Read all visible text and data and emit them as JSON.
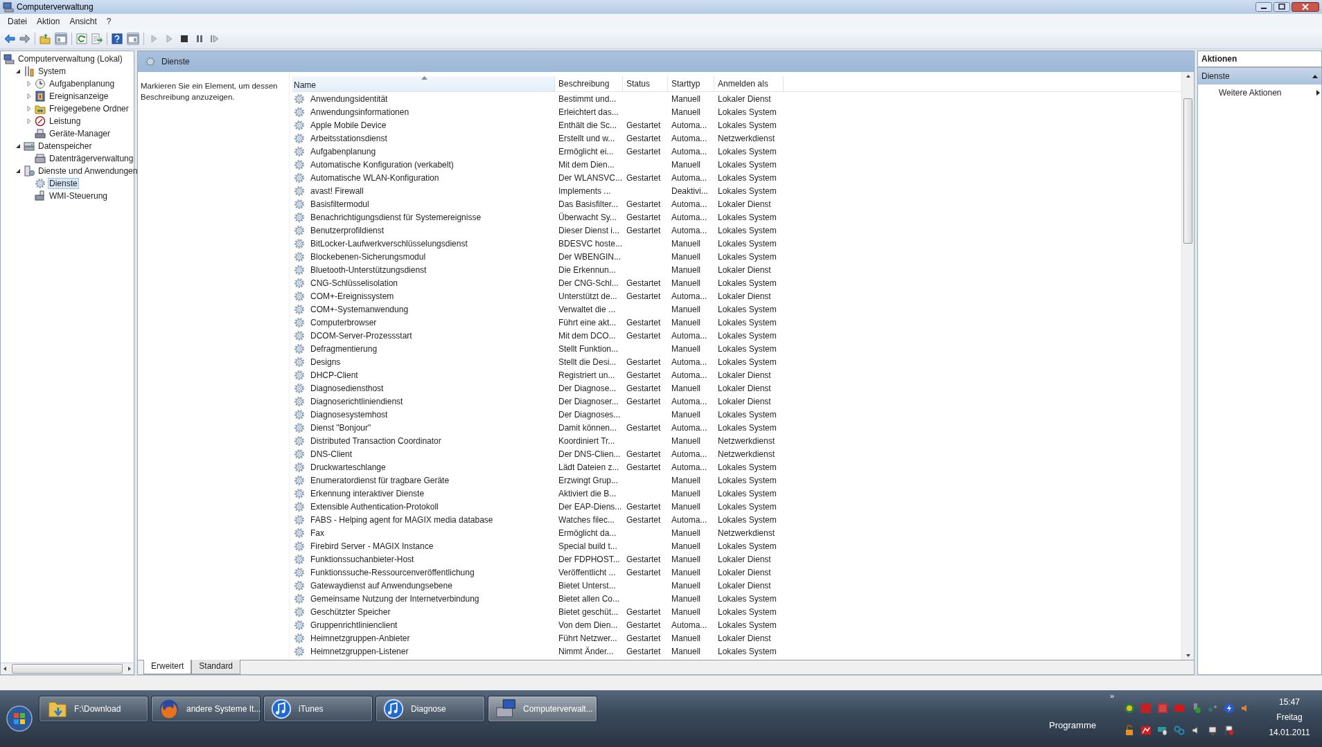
{
  "window": {
    "title": "Computerverwaltung"
  },
  "menu": [
    "Datei",
    "Aktion",
    "Ansicht",
    "?"
  ],
  "tree": {
    "label": "Computerverwaltung (Lokal)",
    "selected": false,
    "children": [
      {
        "label": "System",
        "expanded": true,
        "selected": false,
        "children": [
          {
            "label": "Aufgabenplanung",
            "expanded": false,
            "selected": false
          },
          {
            "label": "Ereignisanzeige",
            "expanded": false,
            "selected": false
          },
          {
            "label": "Freigegebene Ordner",
            "expanded": false,
            "selected": false
          },
          {
            "label": "Leistung",
            "expanded": false,
            "selected": false
          },
          {
            "label": "Geräte-Manager",
            "selected": false
          }
        ]
      },
      {
        "label": "Datenspeicher",
        "expanded": true,
        "selected": false,
        "children": [
          {
            "label": "Datenträgerverwaltung",
            "selected": false
          }
        ]
      },
      {
        "label": "Dienste und Anwendungen",
        "expanded": true,
        "selected": false,
        "children": [
          {
            "label": "Dienste",
            "selected": true
          },
          {
            "label": "WMI-Steuerung",
            "selected": false
          }
        ]
      }
    ]
  },
  "panel_title": "Dienste",
  "description_hint": "Markieren Sie ein Element, um dessen Beschreibung anzuzeigen.",
  "columns": [
    {
      "label": "Name",
      "sorted": true
    },
    {
      "label": "Beschreibung",
      "sorted": false
    },
    {
      "label": "Status",
      "sorted": false
    },
    {
      "label": "Starttyp",
      "sorted": false
    },
    {
      "label": "Anmelden als",
      "sorted": false
    }
  ],
  "rows": [
    {
      "name": "Anwendungsidentität",
      "description": "Bestimmt und...",
      "startup": "Manuell",
      "logon": "Lokaler Dienst"
    },
    {
      "name": "Anwendungsinformationen",
      "description": "Erleichtert das...",
      "startup": "Manuell",
      "logon": "Lokales System"
    },
    {
      "name": "Apple Mobile Device",
      "description": "Enthält die Sc...",
      "status": "Gestartet",
      "startup": "Automa...",
      "logon": "Lokales System"
    },
    {
      "name": "Arbeitsstationsdienst",
      "description": "Erstellt und w...",
      "status": "Gestartet",
      "startup": "Automa...",
      "logon": "Netzwerkdienst"
    },
    {
      "name": "Aufgabenplanung",
      "description": "Ermöglicht ei...",
      "status": "Gestartet",
      "startup": "Automa...",
      "logon": "Lokales System"
    },
    {
      "name": "Automatische Konfiguration (verkabelt)",
      "description": "Mit dem Dien...",
      "startup": "Manuell",
      "logon": "Lokales System"
    },
    {
      "name": "Automatische WLAN-Konfiguration",
      "description": "Der WLANSVC...",
      "status": "Gestartet",
      "startup": "Automa...",
      "logon": "Lokales System"
    },
    {
      "name": "avast! Firewall",
      "description": "Implements ...",
      "startup": "Deaktivi...",
      "logon": "Lokales System"
    },
    {
      "name": "Basisfiltermodul",
      "description": "Das Basisfilter...",
      "status": "Gestartet",
      "startup": "Automa...",
      "logon": "Lokaler Dienst"
    },
    {
      "name": "Benachrichtigungsdienst für Systemereignisse",
      "description": "Überwacht Sy...",
      "status": "Gestartet",
      "startup": "Automa...",
      "logon": "Lokales System"
    },
    {
      "name": "Benutzerprofildienst",
      "description": "Dieser Dienst i...",
      "status": "Gestartet",
      "startup": "Automa...",
      "logon": "Lokales System"
    },
    {
      "name": "BitLocker-Laufwerkverschlüsselungsdienst",
      "description": "BDESVC hoste...",
      "startup": "Manuell",
      "logon": "Lokales System"
    },
    {
      "name": "Blockebenen-Sicherungsmodul",
      "description": "Der WBENGIN...",
      "startup": "Manuell",
      "logon": "Lokales System"
    },
    {
      "name": "Bluetooth-Unterstützungsdienst",
      "description": "Die Erkennun...",
      "startup": "Manuell",
      "logon": "Lokaler Dienst"
    },
    {
      "name": "CNG-Schlüsselisolation",
      "description": "Der CNG-Schl...",
      "status": "Gestartet",
      "startup": "Manuell",
      "logon": "Lokales System"
    },
    {
      "name": "COM+-Ereignissystem",
      "description": "Unterstützt de...",
      "status": "Gestartet",
      "startup": "Automa...",
      "logon": "Lokaler Dienst"
    },
    {
      "name": "COM+-Systemanwendung",
      "description": "Verwaltet die ...",
      "startup": "Manuell",
      "logon": "Lokales System"
    },
    {
      "name": "Computerbrowser",
      "description": "Führt eine akt...",
      "status": "Gestartet",
      "startup": "Manuell",
      "logon": "Lokales System"
    },
    {
      "name": "DCOM-Server-Prozessstart",
      "description": "Mit dem DCO...",
      "status": "Gestartet",
      "startup": "Automa...",
      "logon": "Lokales System"
    },
    {
      "name": "Defragmentierung",
      "description": "Stellt Funktion...",
      "startup": "Manuell",
      "logon": "Lokales System"
    },
    {
      "name": "Designs",
      "description": "Stellt die Desi...",
      "status": "Gestartet",
      "startup": "Automa...",
      "logon": "Lokales System"
    },
    {
      "name": "DHCP-Client",
      "description": "Registriert un...",
      "status": "Gestartet",
      "startup": "Automa...",
      "logon": "Lokaler Dienst"
    },
    {
      "name": "Diagnosediensthost",
      "description": "Der Diagnose...",
      "status": "Gestartet",
      "startup": "Manuell",
      "logon": "Lokaler Dienst"
    },
    {
      "name": "Diagnoserichtliniendienst",
      "description": "Der Diagnoser...",
      "status": "Gestartet",
      "startup": "Automa...",
      "logon": "Lokaler Dienst"
    },
    {
      "name": "Diagnosesystemhost",
      "description": "Der Diagnoses...",
      "startup": "Manuell",
      "logon": "Lokales System"
    },
    {
      "name": "Dienst \"Bonjour\"",
      "description": "Damit können...",
      "status": "Gestartet",
      "startup": "Automa...",
      "logon": "Lokales System"
    },
    {
      "name": "Distributed Transaction Coordinator",
      "description": "Koordiniert Tr...",
      "startup": "Manuell",
      "logon": "Netzwerkdienst"
    },
    {
      "name": "DNS-Client",
      "description": "Der DNS-Clien...",
      "status": "Gestartet",
      "startup": "Automa...",
      "logon": "Netzwerkdienst"
    },
    {
      "name": "Druckwarteschlange",
      "description": "Lädt Dateien z...",
      "status": "Gestartet",
      "startup": "Automa...",
      "logon": "Lokales System"
    },
    {
      "name": "Enumeratordienst für tragbare Geräte",
      "description": "Erzwingt Grup...",
      "startup": "Manuell",
      "logon": "Lokales System"
    },
    {
      "name": "Erkennung interaktiver Dienste",
      "description": "Aktiviert die B...",
      "startup": "Manuell",
      "logon": "Lokales System"
    },
    {
      "name": "Extensible Authentication-Protokoll",
      "description": "Der EAP-Diens...",
      "status": "Gestartet",
      "startup": "Manuell",
      "logon": "Lokales System"
    },
    {
      "name": "FABS - Helping agent for MAGIX media database",
      "description": "Watches filec...",
      "status": "Gestartet",
      "startup": "Automa...",
      "logon": "Lokales System"
    },
    {
      "name": "Fax",
      "description": "Ermöglicht da...",
      "startup": "Manuell",
      "logon": "Netzwerkdienst"
    },
    {
      "name": "Firebird Server - MAGIX Instance",
      "description": "Special build t...",
      "startup": "Manuell",
      "logon": "Lokales System"
    },
    {
      "name": "Funktionssuchanbieter-Host",
      "description": "Der FDPHOST...",
      "status": "Gestartet",
      "startup": "Manuell",
      "logon": "Lokaler Dienst"
    },
    {
      "name": "Funktionssuche-Ressourcenveröffentlichung",
      "description": "Veröffentlicht ...",
      "status": "Gestartet",
      "startup": "Manuell",
      "logon": "Lokaler Dienst"
    },
    {
      "name": "Gatewaydienst auf Anwendungsebene",
      "description": "Bietet Unterst...",
      "startup": "Manuell",
      "logon": "Lokaler Dienst"
    },
    {
      "name": "Gemeinsame Nutzung der Internetverbindung",
      "description": "Bietet allen Co...",
      "startup": "Manuell",
      "logon": "Lokales System"
    },
    {
      "name": "Geschützter Speicher",
      "description": "Bietet geschüt...",
      "status": "Gestartet",
      "startup": "Manuell",
      "logon": "Lokales System"
    },
    {
      "name": "Gruppenrichtlinienclient",
      "description": "Von dem Dien...",
      "status": "Gestartet",
      "startup": "Automa...",
      "logon": "Lokales System"
    },
    {
      "name": "Heimnetzgruppen-Anbieter",
      "description": "Führt Netzwer...",
      "status": "Gestartet",
      "startup": "Manuell",
      "logon": "Lokaler Dienst"
    },
    {
      "name": "Heimnetzgruppen-Listener",
      "description": "Nimmt Änder...",
      "status": "Gestartet",
      "startup": "Manuell",
      "logon": "Lokales System"
    }
  ],
  "view_tabs": [
    {
      "label": "Erweitert",
      "selected": true
    },
    {
      "label": "Standard",
      "selected": false
    }
  ],
  "actions": {
    "title": "Aktionen",
    "section": "Dienste",
    "items": [
      "Weitere Aktionen"
    ]
  },
  "taskbar": {
    "buttons": [
      {
        "label": "F:\\Download",
        "selected": false
      },
      {
        "label": "andere Systeme It...",
        "selected": false
      },
      {
        "label": "iTunes",
        "selected": false
      },
      {
        "label": "Diagnose",
        "selected": false
      },
      {
        "label": "Computerverwalt...",
        "selected": true
      }
    ],
    "overflow": "»",
    "programs_label": "Programme",
    "clock": {
      "time": "15:47",
      "day": "Freitag",
      "date": "14.01.2011"
    }
  }
}
